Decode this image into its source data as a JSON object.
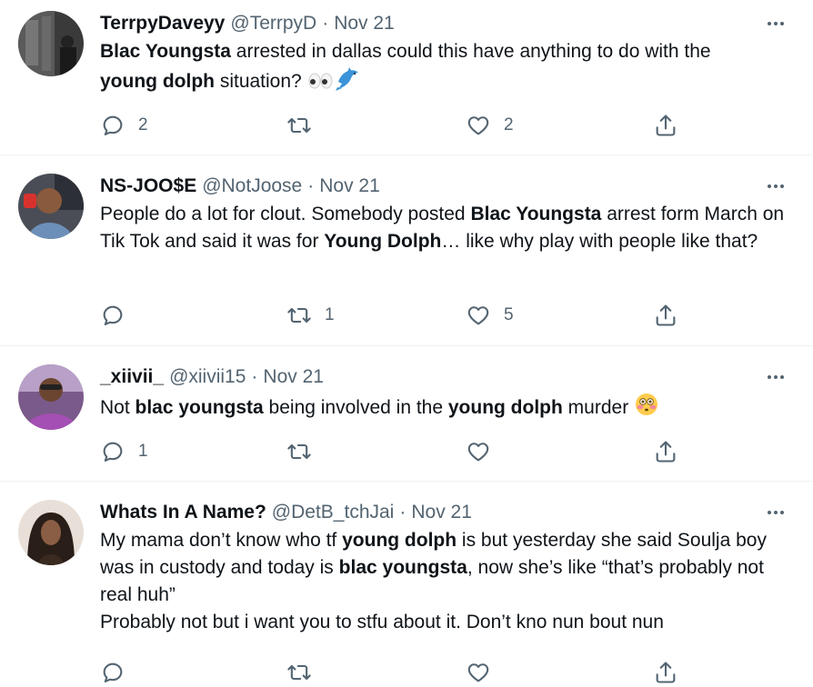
{
  "tweets": [
    {
      "name": "TerrpyDaveyy",
      "handle": "@TerrpyD",
      "separator": "·",
      "date": "Nov 21",
      "text_segments": [
        {
          "t": "Blac Youngsta",
          "b": true
        },
        {
          "t": " arrested in dallas could this have anything  to do with the ",
          "b": false
        },
        {
          "t": "young dolph",
          "b": true
        },
        {
          "t": " situation? ",
          "b": false
        }
      ],
      "emojis": [
        "eyes-emoji",
        "dolphin-emoji"
      ],
      "replies": "2",
      "retweets": "",
      "likes": "2"
    },
    {
      "name": "NS-JOO$E",
      "handle": "@NotJoose",
      "separator": "·",
      "date": "Nov 21",
      "text_segments": [
        {
          "t": "People do a lot for clout. Somebody posted ",
          "b": false
        },
        {
          "t": "Blac Youngsta",
          "b": true
        },
        {
          "t": " arrest form March on Tik Tok and said it was for ",
          "b": false
        },
        {
          "t": "Young Dolph",
          "b": true
        },
        {
          "t": "… like why play with people like that?",
          "b": false
        }
      ],
      "emojis": [],
      "replies": "",
      "retweets": "1",
      "likes": "5"
    },
    {
      "name": "_xiivii_",
      "handle": "@xiivii15",
      "separator": "·",
      "date": "Nov 21",
      "text_segments": [
        {
          "t": "Not ",
          "b": false
        },
        {
          "t": "blac youngsta",
          "b": true
        },
        {
          "t": " being involved in the ",
          "b": false
        },
        {
          "t": "young dolph",
          "b": true
        },
        {
          "t": " murder ",
          "b": false
        }
      ],
      "emojis": [
        "flushed-emoji"
      ],
      "replies": "1",
      "retweets": "",
      "likes": ""
    },
    {
      "name": "Whats In A Name?",
      "handle": "@DetB_tchJai",
      "separator": "·",
      "date": "Nov 21",
      "text_segments": [
        {
          "t": "My mama don’t know who tf ",
          "b": false
        },
        {
          "t": "young dolph",
          "b": true
        },
        {
          "t": " is but yesterday she said Soulja boy was in custody and today is ",
          "b": false
        },
        {
          "t": "blac youngsta",
          "b": true
        },
        {
          "t": ", now she’s like “that’s probably not real huh”",
          "b": false
        },
        {
          "t": "\nProbably not but i want you to stfu about it. Don’t kno nun bout nun",
          "b": false
        }
      ],
      "emojis": [],
      "replies": "",
      "retweets": "",
      "likes": ""
    }
  ],
  "colors": {
    "text": "#0f1419",
    "secondary": "#536471",
    "divider": "#eff3f4"
  },
  "icons": [
    "reply-icon",
    "retweet-icon",
    "like-icon",
    "share-icon",
    "more-icon"
  ]
}
